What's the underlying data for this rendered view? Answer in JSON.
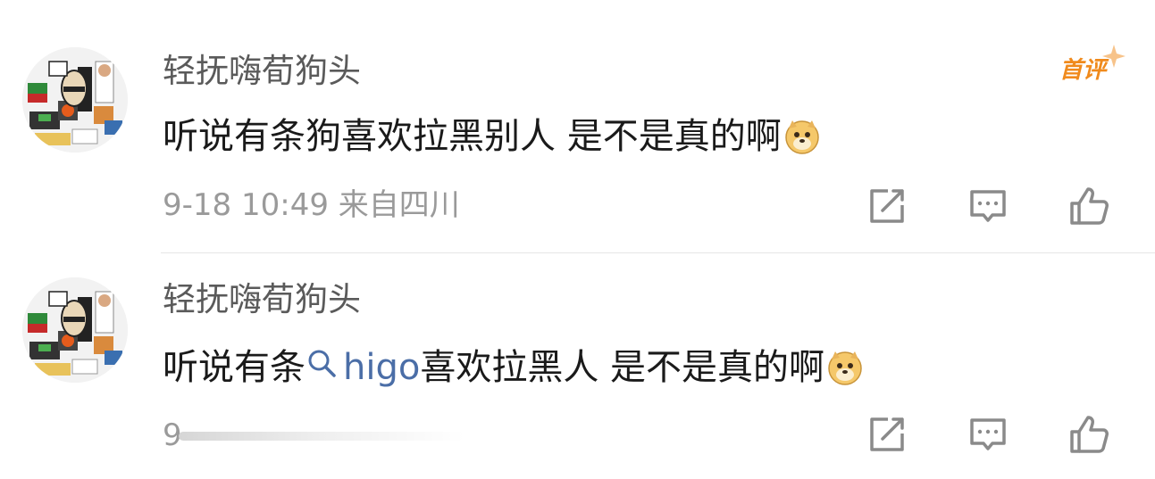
{
  "comments": [
    {
      "username": "轻抚嗨荀狗头",
      "badge": "首评",
      "content": "听说有条狗喜欢拉黑别人 是不是真的啊",
      "emoji": "doge-emoji",
      "time": "9-18 10:49",
      "location": "来自四川",
      "actions": {
        "share": "share-icon",
        "reply": "comment-icon",
        "like": "thumbs-up-icon"
      }
    },
    {
      "username": "轻抚嗨荀狗头",
      "content_prefix": "听说有条",
      "topic_link": "higo",
      "content_suffix": "喜欢拉黑人 是不是真的啊",
      "emoji": "doge-emoji",
      "time_partial": "9",
      "actions": {
        "share": "share-icon",
        "reply": "comment-icon",
        "like": "thumbs-up-icon"
      }
    }
  ],
  "colors": {
    "username": "#5a5a5a",
    "text": "#1a1a1a",
    "meta": "#9a9a9a",
    "link": "#4b6ea7",
    "badge": "#f08a1c",
    "icon": "#8a8a8a"
  }
}
